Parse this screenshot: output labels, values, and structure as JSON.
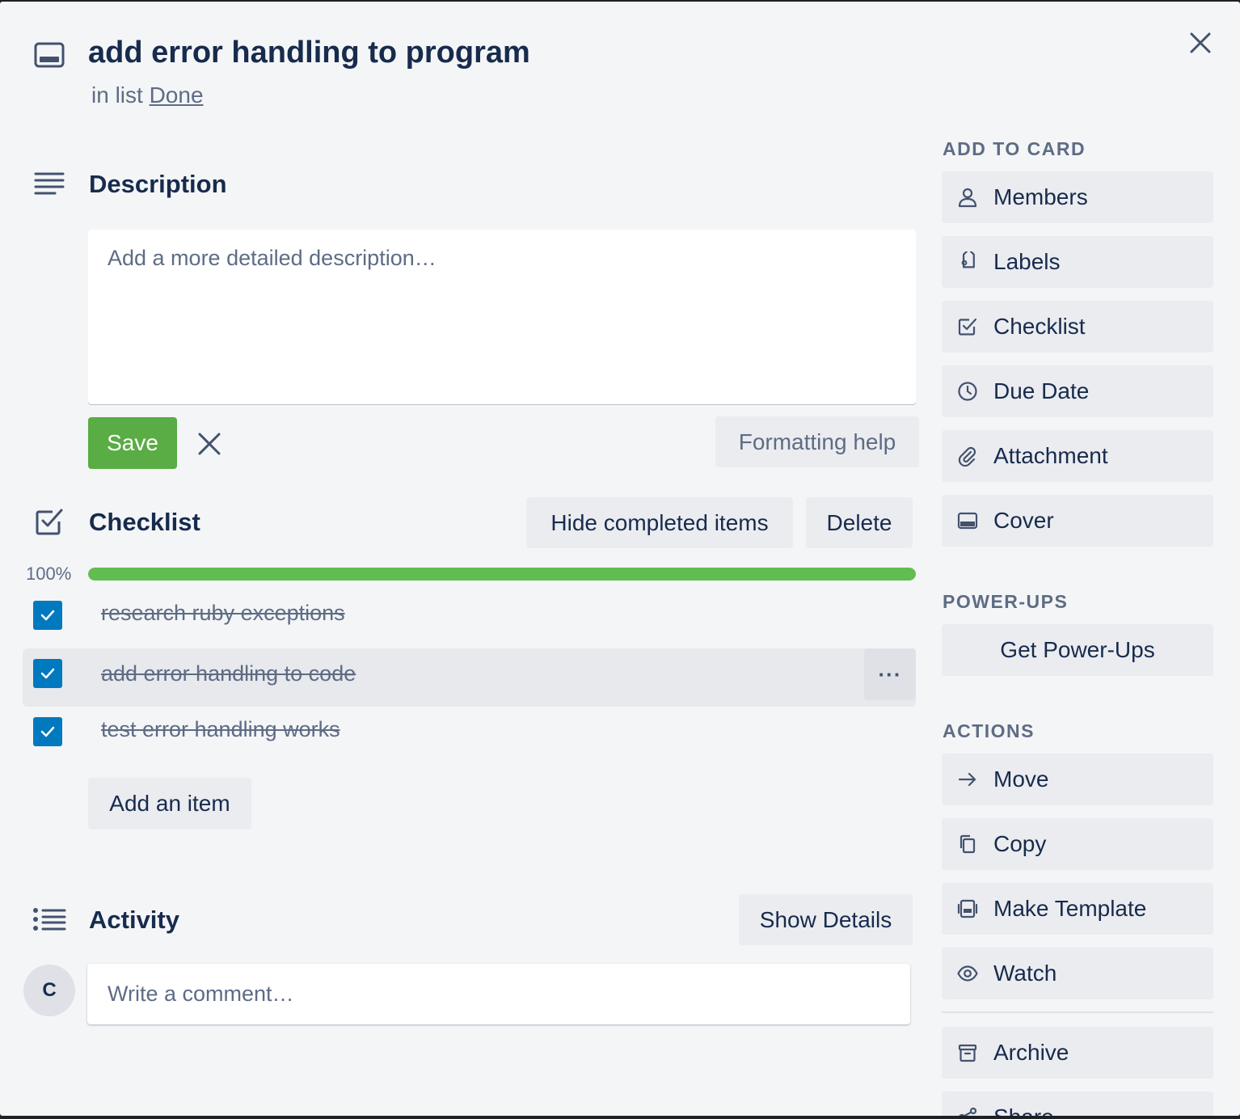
{
  "card": {
    "title": "add error handling to program",
    "in_list_prefix": "in list",
    "list_name": "Done"
  },
  "description": {
    "heading": "Description",
    "placeholder": "Add a more detailed description…",
    "save_label": "Save",
    "formatting_help_label": "Formatting help"
  },
  "checklist": {
    "heading": "Checklist",
    "hide_completed_label": "Hide completed items",
    "delete_label": "Delete",
    "progress_text": "100%",
    "progress_fraction": 1.0,
    "items": [
      {
        "text": "research ruby exceptions",
        "checked": true
      },
      {
        "text": "add error handling to code",
        "checked": true
      },
      {
        "text": "test error handling works",
        "checked": true
      }
    ],
    "more_label": "···",
    "add_item_label": "Add an item"
  },
  "activity": {
    "heading": "Activity",
    "show_details_label": "Show Details",
    "avatar_initial": "C",
    "comment_placeholder": "Write a comment…"
  },
  "sidebar": {
    "add_to_card_heading": "ADD TO CARD",
    "add_to_card": [
      {
        "label": "Members",
        "icon": "person-icon"
      },
      {
        "label": "Labels",
        "icon": "tag-icon"
      },
      {
        "label": "Checklist",
        "icon": "checkbox-icon"
      },
      {
        "label": "Due Date",
        "icon": "clock-icon"
      },
      {
        "label": "Attachment",
        "icon": "paperclip-icon"
      },
      {
        "label": "Cover",
        "icon": "card-cover-icon"
      }
    ],
    "power_ups_heading": "POWER-UPS",
    "get_power_ups_label": "Get Power-Ups",
    "actions_heading": "ACTIONS",
    "actions": [
      {
        "label": "Move",
        "icon": "arrow-right-icon"
      },
      {
        "label": "Copy",
        "icon": "copy-icon"
      },
      {
        "label": "Make Template",
        "icon": "template-icon"
      },
      {
        "label": "Watch",
        "icon": "eye-icon"
      },
      {
        "label": "Archive",
        "icon": "archive-icon"
      },
      {
        "label": "Share",
        "icon": "share-icon"
      }
    ]
  },
  "colors": {
    "save_green": "#5aac44",
    "progress_green": "#61bd4f",
    "checkbox_blue": "#0079bf"
  }
}
